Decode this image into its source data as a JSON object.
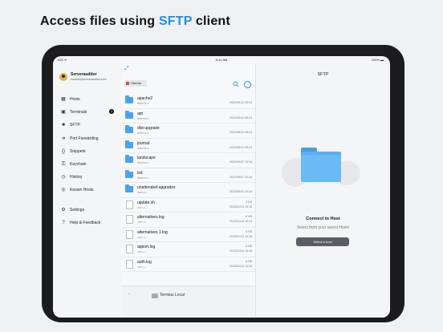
{
  "headline": {
    "prefix": "Access files using ",
    "highlight": "SFTP",
    "suffix": " client"
  },
  "statusbar": {
    "left": "iOS  ᯤ",
    "time": "9:41 AM",
    "battery": "100% ▬"
  },
  "user": {
    "name": "Serverauditor",
    "email": "maksim@serverauditor.com"
  },
  "sidebar": {
    "items": [
      {
        "icon": "▦",
        "label": "Hosts"
      },
      {
        "icon": "▣",
        "label": "Terminals",
        "badge": "1"
      },
      {
        "icon": "■",
        "label": "SFTP"
      },
      {
        "icon": "➜",
        "label": "Port Forwarding"
      },
      {
        "icon": "{}",
        "label": "Snippets"
      },
      {
        "icon": "⚿",
        "label": "Keychain"
      },
      {
        "icon": "◷",
        "label": "History"
      },
      {
        "icon": "◎",
        "label": "Known Hosts"
      }
    ],
    "bottom_items": [
      {
        "icon": "⚙",
        "label": "Settings"
      },
      {
        "icon": "?",
        "label": "Help & Feedback"
      }
    ]
  },
  "filepane": {
    "expand_icon": "⤢",
    "host_tag": "Ubuntu",
    "more": "···",
    "files": [
      {
        "type": "folder",
        "name": "apache2",
        "perm": "drwxr-xr-x",
        "date": "2022/09/12 09:24"
      },
      {
        "type": "folder",
        "name": "apt",
        "perm": "drwxr-xr-x",
        "date": "2022/09/12 09:24"
      },
      {
        "type": "folder",
        "name": "dist-upgrade",
        "perm": "drwxr-xr-x",
        "date": "2022/09/12 09:24"
      },
      {
        "type": "folder",
        "name": "journal",
        "perm": "drwxr-sr-x",
        "date": "2022/09/12 09:24"
      },
      {
        "type": "folder",
        "name": "landscape",
        "perm": "drwxr-xr-x",
        "date": "2022/09/07 10:16"
      },
      {
        "type": "folder",
        "name": "lxd",
        "perm": "drwxr-xr-x",
        "date": "2022/09/07 10:16"
      },
      {
        "type": "folder",
        "name": "unattended-upgrades",
        "perm": "drwxr-x---",
        "date": "2022/09/01 10:16"
      },
      {
        "type": "file",
        "name": "update.sh",
        "perm": "-rw-r--r--",
        "size": "0 KB",
        "date": "2023/01/14 10:16"
      },
      {
        "type": "file",
        "name": "alternatives.log",
        "perm": "-rw-r--r--",
        "size": "6 KB",
        "date": "2023/01/14 10:16"
      },
      {
        "type": "file",
        "name": "alternatives 1.log",
        "perm": "-rw-r--r--",
        "size": "6 KB",
        "date": "2023/01/14 10:16"
      },
      {
        "type": "file",
        "name": "apport.log",
        "perm": "-rw-r-----",
        "size": "6 KB",
        "date": "2023/01/14 10:16"
      },
      {
        "type": "file",
        "name": "auth.log",
        "perm": "-rw-r-----",
        "size": "6 KB",
        "date": "2023/01/14 10:16"
      }
    ],
    "back_arrow": "‹",
    "location": "Termius Local"
  },
  "main": {
    "title": "SFTP",
    "connect_title": "Connect to Host",
    "connect_sub": "Select from your saved Hosts",
    "button": "Select a host"
  }
}
